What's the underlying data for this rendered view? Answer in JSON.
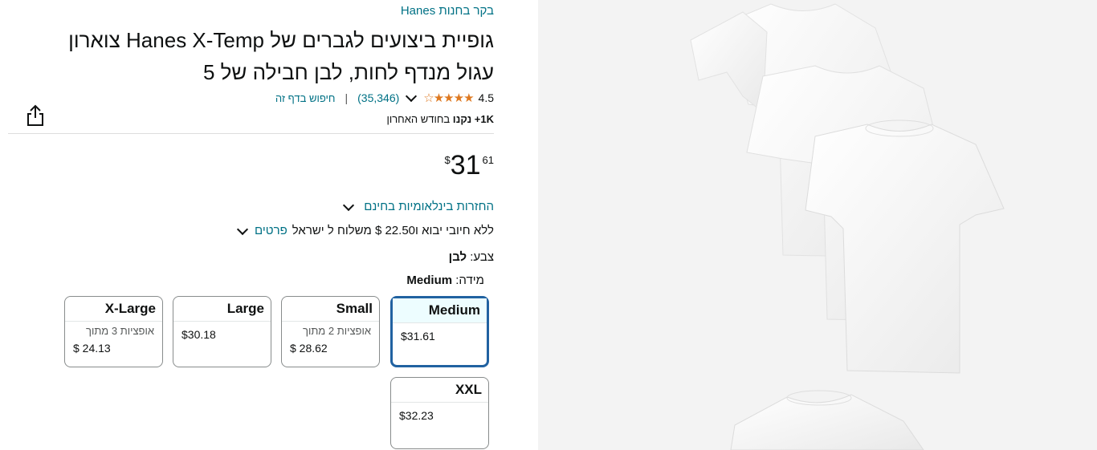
{
  "store": {
    "link_label": "בקר בחנות Hanes"
  },
  "product": {
    "title_line1": "גופיית ביצועים לגברים של Hanes X-Temp צוארון",
    "title_line2": "עגול מנדף לחות, לבן חבילה של 5"
  },
  "rating": {
    "value": "4.5",
    "stars": "★★★★☆",
    "count": "(35,346)",
    "search_link": "חיפוש בדף זה"
  },
  "bought": {
    "bold": "1K+ נקנו",
    "rest": "בחודש האחרון"
  },
  "price": {
    "symbol": "$",
    "whole": "31",
    "fraction": "61"
  },
  "returns": {
    "label": "החזרות בינלאומיות בחינם"
  },
  "shipping": {
    "text": "ללא חיובי יבוא ו22.50 $ משלוח ל ישראל",
    "details": "פרטים"
  },
  "color": {
    "label": "צבע:",
    "value": "לבן"
  },
  "size": {
    "label": "מידה:",
    "value": "Medium",
    "options": [
      {
        "name": "Medium",
        "price": "$31.61",
        "selected": true
      },
      {
        "name": "Small",
        "options_text": "אופציות 2 מתוך",
        "price": "$ 28.62"
      },
      {
        "name": "Large",
        "price": "$30.18"
      },
      {
        "name": "X-Large",
        "options_text": "אופציות 3 מתוך",
        "price": "$ 24.13"
      },
      {
        "name": "XXL",
        "price": "$32.23"
      }
    ]
  },
  "icons": {
    "share": "share-icon",
    "rating_chevron": "chevron-down-icon"
  },
  "colors": {
    "link": "#007185",
    "stars": "#de7921",
    "selected_border": "#2162a1"
  }
}
